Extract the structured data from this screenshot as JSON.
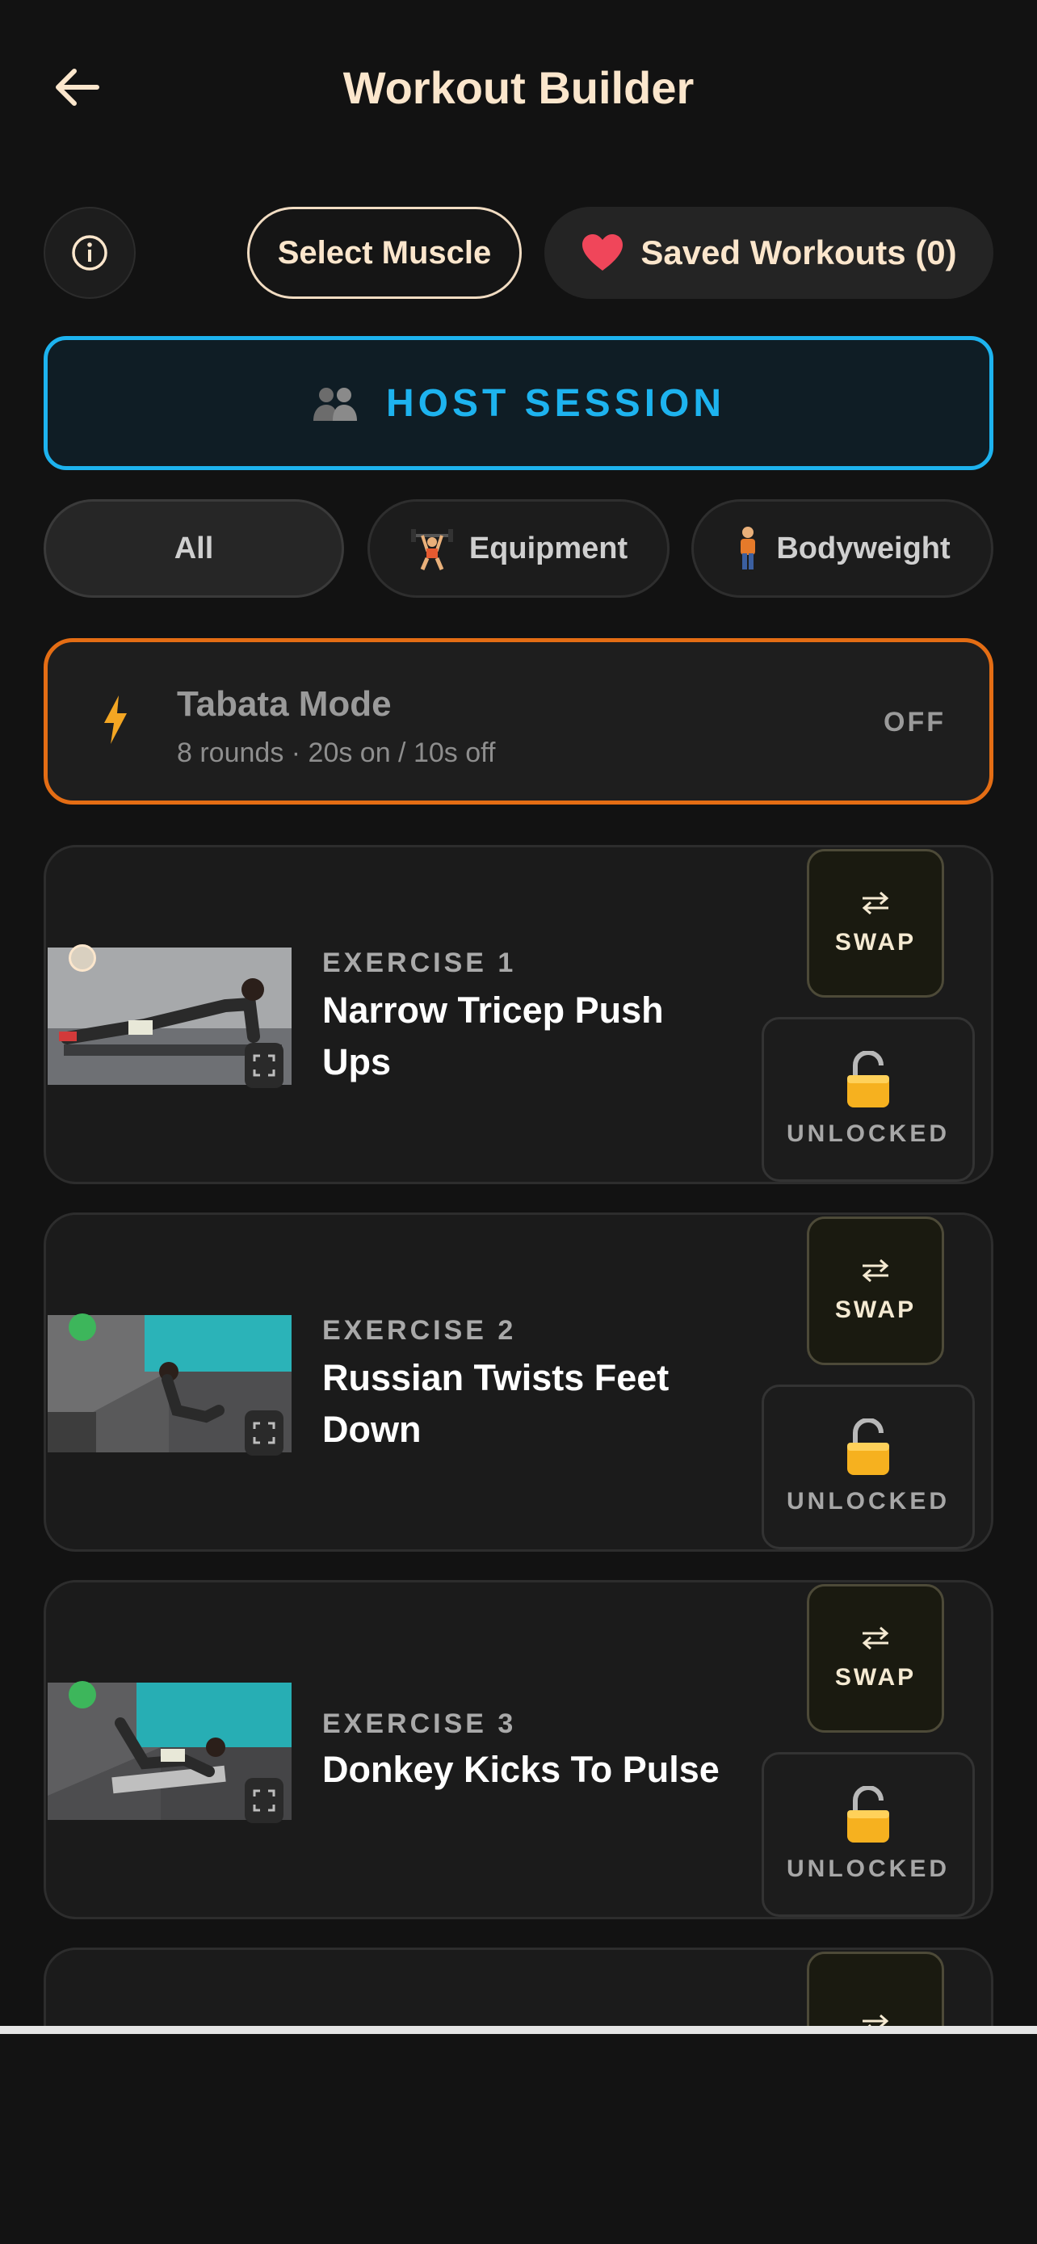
{
  "header": {
    "title": "Workout Builder"
  },
  "controls": {
    "select_muscle": "Select Muscle",
    "saved_workouts": "Saved Workouts (0)",
    "host_session": "HOST SESSION"
  },
  "filters": [
    {
      "label": "All"
    },
    {
      "label": "Equipment"
    },
    {
      "label": "Bodyweight"
    }
  ],
  "tabata": {
    "title": "Tabata Mode",
    "subtitle": "8 rounds  ·  20s on / 10s off",
    "state": "OFF"
  },
  "exercises": [
    {
      "number_label": "EXERCISE 1",
      "name": "Narrow Tricep Push Ups",
      "swap_label": "SWAP",
      "lock_label": "UNLOCKED"
    },
    {
      "number_label": "EXERCISE 2",
      "name": "Russian Twists Feet Down",
      "swap_label": "SWAP",
      "lock_label": "UNLOCKED"
    },
    {
      "number_label": "EXERCISE 3",
      "name": "Donkey Kicks To Pulse",
      "swap_label": "SWAP",
      "lock_label": "UNLOCKED"
    }
  ],
  "colors": {
    "accent_cream": "#fbe6cc",
    "host_blue": "#1db3ef",
    "tabata_orange": "#e46d14",
    "status_green": "#3db65b"
  }
}
